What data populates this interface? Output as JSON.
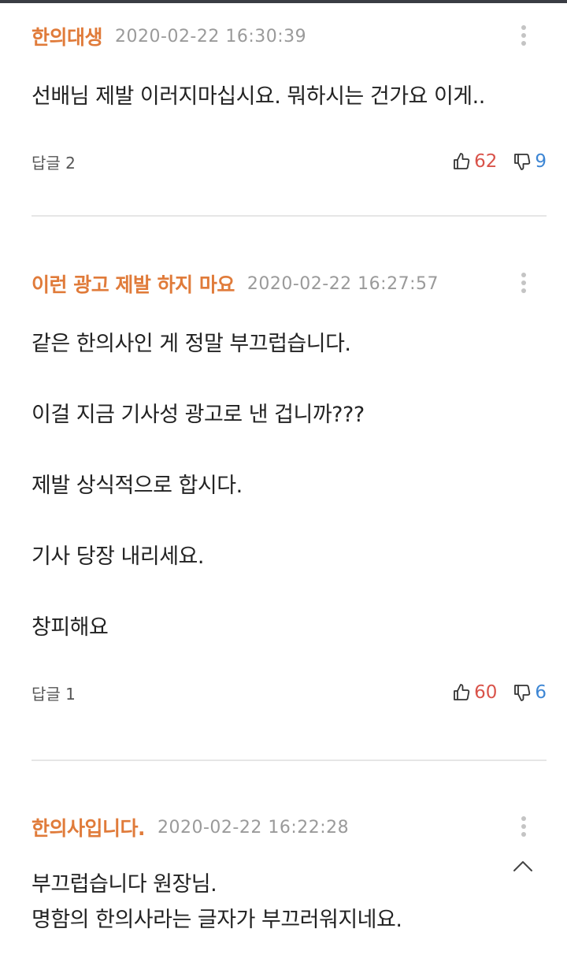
{
  "comments": [
    {
      "author": "한의대생",
      "timestamp": "2020-02-22 16:30:39",
      "lines": [
        "선배님 제발 이러지마십시요. 뭐하시는 건가요 이게.."
      ],
      "reply_label": "답글 2",
      "likes": "62",
      "dislikes": "9"
    },
    {
      "author": "이런 광고 제발 하지 마요",
      "timestamp": "2020-02-22 16:27:57",
      "lines": [
        "같은 한의사인 게 정말 부끄럽습니다.",
        "이걸 지금 기사성 광고로 낸 겁니까???",
        "제발 상식적으로 합시다.",
        "기사 당장 내리세요.",
        "창피해요"
      ],
      "reply_label": "답글 1",
      "likes": "60",
      "dislikes": "6"
    },
    {
      "author": "한의사입니다.",
      "timestamp": "2020-02-22 16:22:28",
      "lines": [
        "부끄럽습니다 원장님.",
        "명함의 한의사라는 글자가 부끄러워지네요."
      ]
    }
  ],
  "icons": {
    "more": "more-vertical-icon",
    "like": "thumbs-up-icon",
    "dislike": "thumbs-down-icon",
    "collapse": "chevron-up-icon"
  },
  "colors": {
    "author": "#e07b3a",
    "timestamp": "#9a9a9a",
    "like_count": "#d9534a",
    "dislike_count": "#3d86d4",
    "divider": "#e6e6e6"
  }
}
